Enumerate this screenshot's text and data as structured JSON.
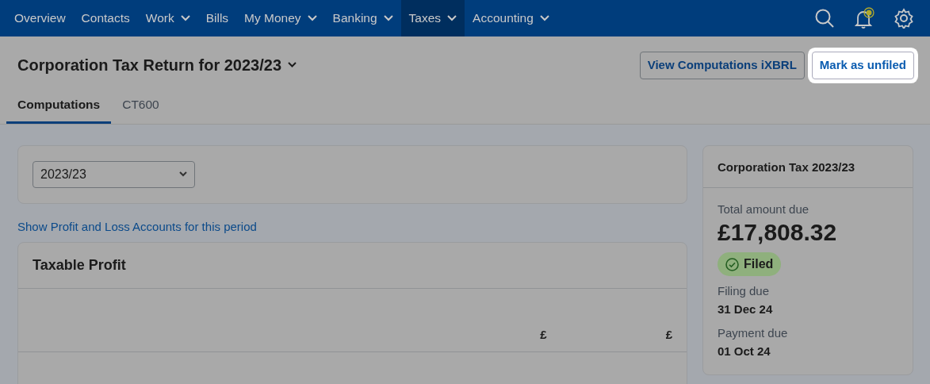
{
  "nav": {
    "items": [
      {
        "label": "Overview",
        "dropdown": false,
        "selected": false
      },
      {
        "label": "Contacts",
        "dropdown": false,
        "selected": false
      },
      {
        "label": "Work",
        "dropdown": true,
        "selected": false
      },
      {
        "label": "Bills",
        "dropdown": false,
        "selected": false
      },
      {
        "label": "My Money",
        "dropdown": true,
        "selected": false
      },
      {
        "label": "Banking",
        "dropdown": true,
        "selected": false
      },
      {
        "label": "Taxes",
        "dropdown": true,
        "selected": true
      },
      {
        "label": "Accounting",
        "dropdown": true,
        "selected": false
      }
    ]
  },
  "page_title": "Corporation Tax Return for 2023/23",
  "actions": [
    {
      "label": "View Computations iXBRL",
      "spotlight": false
    },
    {
      "label": "Mark as unfiled",
      "spotlight": true
    }
  ],
  "tabs": [
    {
      "label": "Computations",
      "selected": true
    },
    {
      "label": "CT600",
      "selected": false
    }
  ],
  "period_select": {
    "value": "2023/23"
  },
  "pl_link": "Show Profit and Loss Accounts for this period",
  "taxable_profit": {
    "title": "Taxable Profit",
    "column_1": "£",
    "column_2": "£"
  },
  "summary": {
    "title": "Corporation Tax 2023/23",
    "total_label": "Total amount due",
    "total": "£17,808.32",
    "status": "Filed",
    "filing_label": "Filing due",
    "filing_due": "31 Dec 24",
    "payment_label": "Payment due",
    "payment_due": "01 Oct 24"
  }
}
